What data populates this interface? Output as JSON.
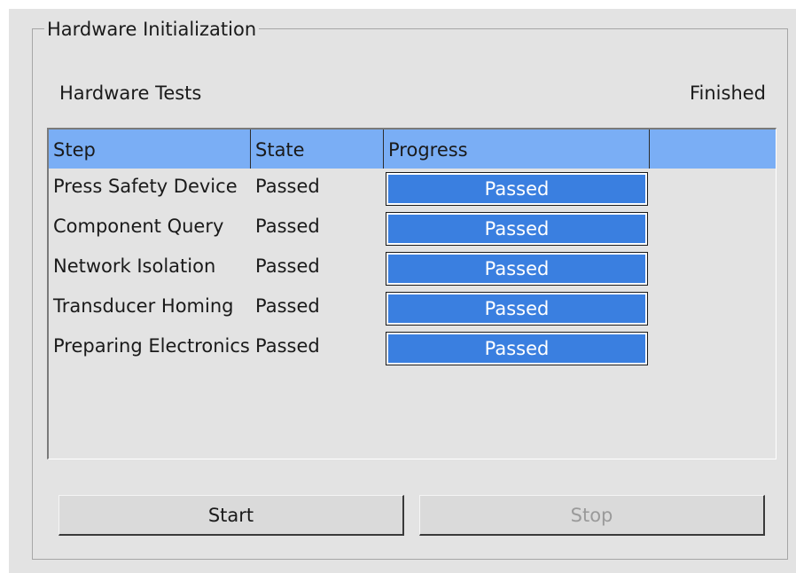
{
  "group": {
    "title": "Hardware Initialization"
  },
  "section": {
    "label": "Hardware Tests",
    "status": "Finished"
  },
  "table": {
    "columns": [
      "Step",
      "State",
      "Progress"
    ],
    "rows": [
      {
        "step": "Press Safety Device",
        "state": "Passed",
        "progress_text": "Passed",
        "progress": 1.0
      },
      {
        "step": "Component Query",
        "state": "Passed",
        "progress_text": "Passed",
        "progress": 1.0
      },
      {
        "step": "Network Isolation",
        "state": "Passed",
        "progress_text": "Passed",
        "progress": 1.0
      },
      {
        "step": "Transducer Homing",
        "state": "Passed",
        "progress_text": "Passed",
        "progress": 1.0
      },
      {
        "step": "Preparing Electronics",
        "state": "Passed",
        "progress_text": "Passed",
        "progress": 1.0
      }
    ]
  },
  "buttons": {
    "start_label": "Start",
    "stop_label": "Stop",
    "stop_enabled": false
  },
  "colors": {
    "header_bg": "#7aaef5",
    "progress_fill": "#3a7fe0",
    "window_bg": "#e3e3e3"
  }
}
